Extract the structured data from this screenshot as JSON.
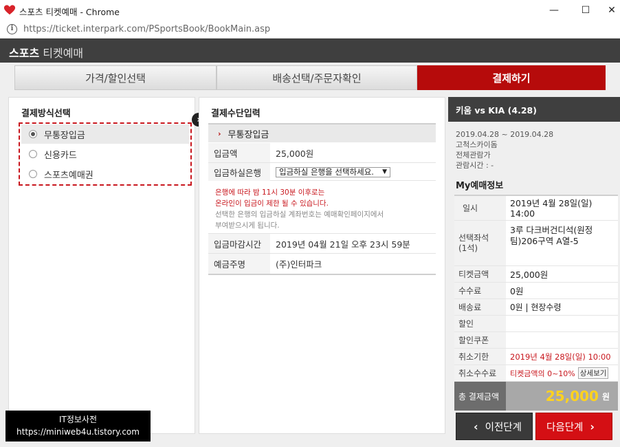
{
  "window": {
    "title": "스포츠 티켓예매 - Chrome",
    "url_host": "https://ticket.interpark.com",
    "url_path": "/PSportsBook/BookMain.asp",
    "min_symbol": "—",
    "max_symbol": "☐",
    "close_symbol": "✕"
  },
  "header": {
    "brand_bold": "스포츠",
    "brand_rest": " 티켓예매"
  },
  "steps": [
    {
      "label": "가격/할인선택",
      "active": false
    },
    {
      "label": "배송선택/주문자확인",
      "active": false
    },
    {
      "label": "결제하기",
      "active": true
    }
  ],
  "payment_methods": {
    "title": "결제방식선택",
    "options": [
      {
        "label": "무통장입금",
        "selected": true
      },
      {
        "label": "신용카드",
        "selected": false
      },
      {
        "label": "스포츠예매권",
        "selected": false
      }
    ]
  },
  "payment_input": {
    "title": "결제수단입력",
    "section": "무통장입금",
    "amount_label": "입금액",
    "amount_value": "25,000원",
    "bank_label": "입금하실은행",
    "bank_select": "입금하실 은행을 선택하세요.",
    "notice_red1": "은행에 따라 밤 11시 30분 이후로는",
    "notice_red2": "온라인이 입금이 제한 될 수 있습니다.",
    "notice_gray1": "선택한 은행의 입금하실 계좌번호는 예매확인페이지에서",
    "notice_gray2": "부여받으시게 됩니다.",
    "deadline_label": "입금마감시간",
    "deadline_value": "2019년 04월 21일 오후 23시 59분",
    "depositor_label": "예금주명",
    "depositor_value": "(주)인터파크"
  },
  "summary": {
    "match": "키움 vs KIA (4.28)",
    "date_range": "2019.04.28 ~ 2019.04.28",
    "venue": "고척스카이돔",
    "rating": "전체관람가",
    "duration": "관람시간 : -",
    "my_title": "My예매정보",
    "rows": {
      "date_k": "일시",
      "date_v1": "2019년 4월 28일(일)",
      "date_v2": "14:00",
      "seat_k1": "선택좌석",
      "seat_k2": "(1석)",
      "seat_v": "3루 다크버건디석(원정팀)206구역 A열-5",
      "price_k": "티켓금액",
      "price_v": "25,000원",
      "fee_k": "수수료",
      "fee_v": "0원",
      "delivery_k": "배송료",
      "delivery_v": "0원 | 현장수령",
      "discount_k": "할인",
      "discount_v": "",
      "coupon_k": "할인쿠폰",
      "coupon_v": "",
      "cancel_deadline_k": "취소기한",
      "cancel_deadline_v": "2019년 4월 28일(일) 10:00",
      "cancel_fee_k": "취소수수료",
      "cancel_fee_v": "티켓금액의 0~10%",
      "detail_btn": "상세보기"
    },
    "total_label": "총 결제금액",
    "total_value": "25,000",
    "total_unit": "원"
  },
  "buttons": {
    "prev": "이전단계",
    "next": "다음단계"
  },
  "watermark": {
    "line1": "IT정보사전",
    "line2": "https://miniweb4u.tistory.com"
  },
  "colors": {
    "accent": "#b60b0b",
    "next_button": "#d40f14",
    "header": "#3f3f3f",
    "total_amount": "#ffd21e"
  }
}
